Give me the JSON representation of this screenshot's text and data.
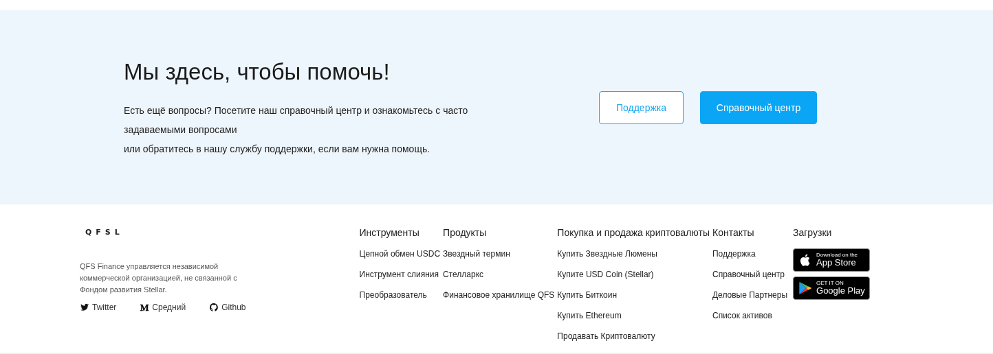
{
  "help": {
    "title": "Мы здесь, чтобы помочь!",
    "lines": [
      "Есть ещё вопросы? Посетите наш справочный центр и ознакомьтесь с часто задаваемыми вопросами",
      "или обратитесь в нашу службу поддержки, если вам нужна помощь."
    ],
    "buttons": [
      {
        "label": "Поддержка",
        "kind": "outline"
      },
      {
        "label": "Справочный центр",
        "kind": "filled"
      }
    ]
  },
  "footer": {
    "logo": "QFSL",
    "about": "QFS Finance управляется независимой коммерческой организацией, не связанной с Фондом развития Stellar.",
    "social": [
      {
        "label": "Twitter",
        "kind": "twitter"
      },
      {
        "label": "Средний",
        "kind": "medium"
      },
      {
        "label": "Github",
        "kind": "github"
      }
    ],
    "columns": [
      {
        "title": "Инструменты",
        "links": [
          "Цепной обмен USDC",
          "Инструмент слияния",
          "Преобразователь"
        ]
      },
      {
        "title": "Продукты",
        "links": [
          "Звездный термин",
          "Стелларкс",
          "Финансовое хранилище QFS"
        ]
      },
      {
        "title": "Покупка и продажа криптовалюты",
        "links": [
          "Купить Звездные Люмены",
          "Купите USD Coin (Stellar)",
          "Купить Биткоин",
          "Купить Ethereum",
          "Продавать Криптовалюту"
        ]
      },
      {
        "title": "Контакты",
        "links": [
          "Поддержка",
          "Справочный центр",
          "Деловые Партнеры",
          "Список активов"
        ]
      }
    ],
    "downloads": {
      "title": "Загрузки",
      "badges": [
        {
          "kind": "apple",
          "small": "Download on the",
          "big": "App Store"
        },
        {
          "kind": "google",
          "small": "GET IT ON",
          "big": "Google Play"
        }
      ]
    }
  }
}
